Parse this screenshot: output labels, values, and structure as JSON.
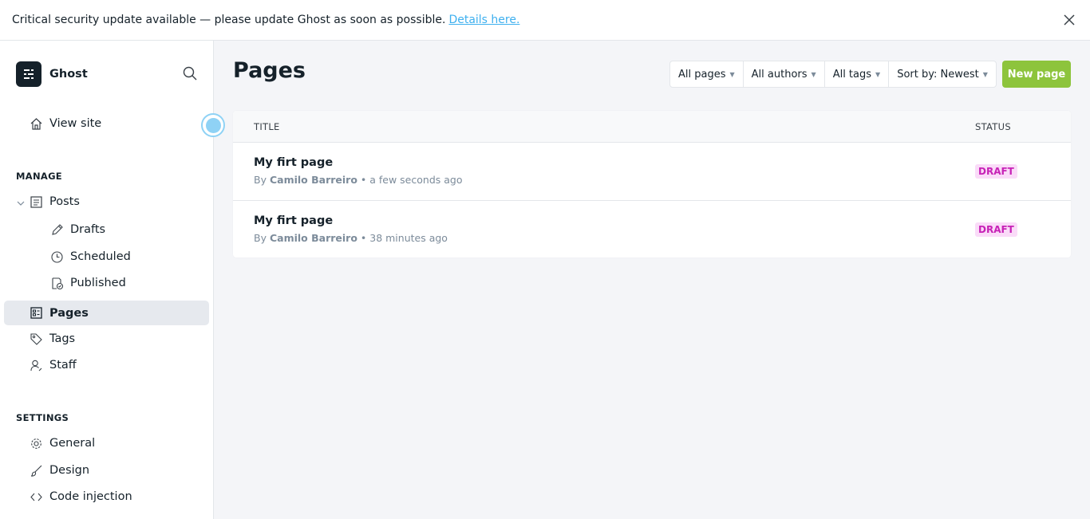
{
  "banner": {
    "message": "Critical security update available — please update Ghost as soon as possible.",
    "link_label": "Details here.",
    "close_icon": "close-icon"
  },
  "sidebar": {
    "brand_name": "Ghost",
    "view_site": "View site",
    "manage_title": "MANAGE",
    "settings_title": "SETTINGS",
    "items": {
      "posts": "Posts",
      "drafts": "Drafts",
      "scheduled": "Scheduled",
      "published": "Published",
      "pages": "Pages",
      "tags": "Tags",
      "staff": "Staff",
      "general": "General",
      "design": "Design",
      "code_injection": "Code injection"
    },
    "active_item": "pages"
  },
  "main": {
    "title": "Pages",
    "filters": {
      "type": "All pages",
      "authors": "All authors",
      "tags": "All tags",
      "sort": "Sort by: Newest"
    },
    "new_button": "New page",
    "table": {
      "col_title": "TITLE",
      "col_status": "STATUS",
      "rows": [
        {
          "title": "My firt page",
          "by": "By",
          "author": "Camilo Barreiro",
          "time": "• a few seconds ago",
          "status": "DRAFT"
        },
        {
          "title": "My firt page",
          "by": "By",
          "author": "Camilo Barreiro",
          "time": "• 38 minutes ago",
          "status": "DRAFT"
        }
      ]
    }
  },
  "colors": {
    "accent_green": "#8dc43c",
    "link_blue": "#3eb0ef",
    "draft_pink": "#c722b6",
    "draft_bg": "#fadbf8"
  }
}
